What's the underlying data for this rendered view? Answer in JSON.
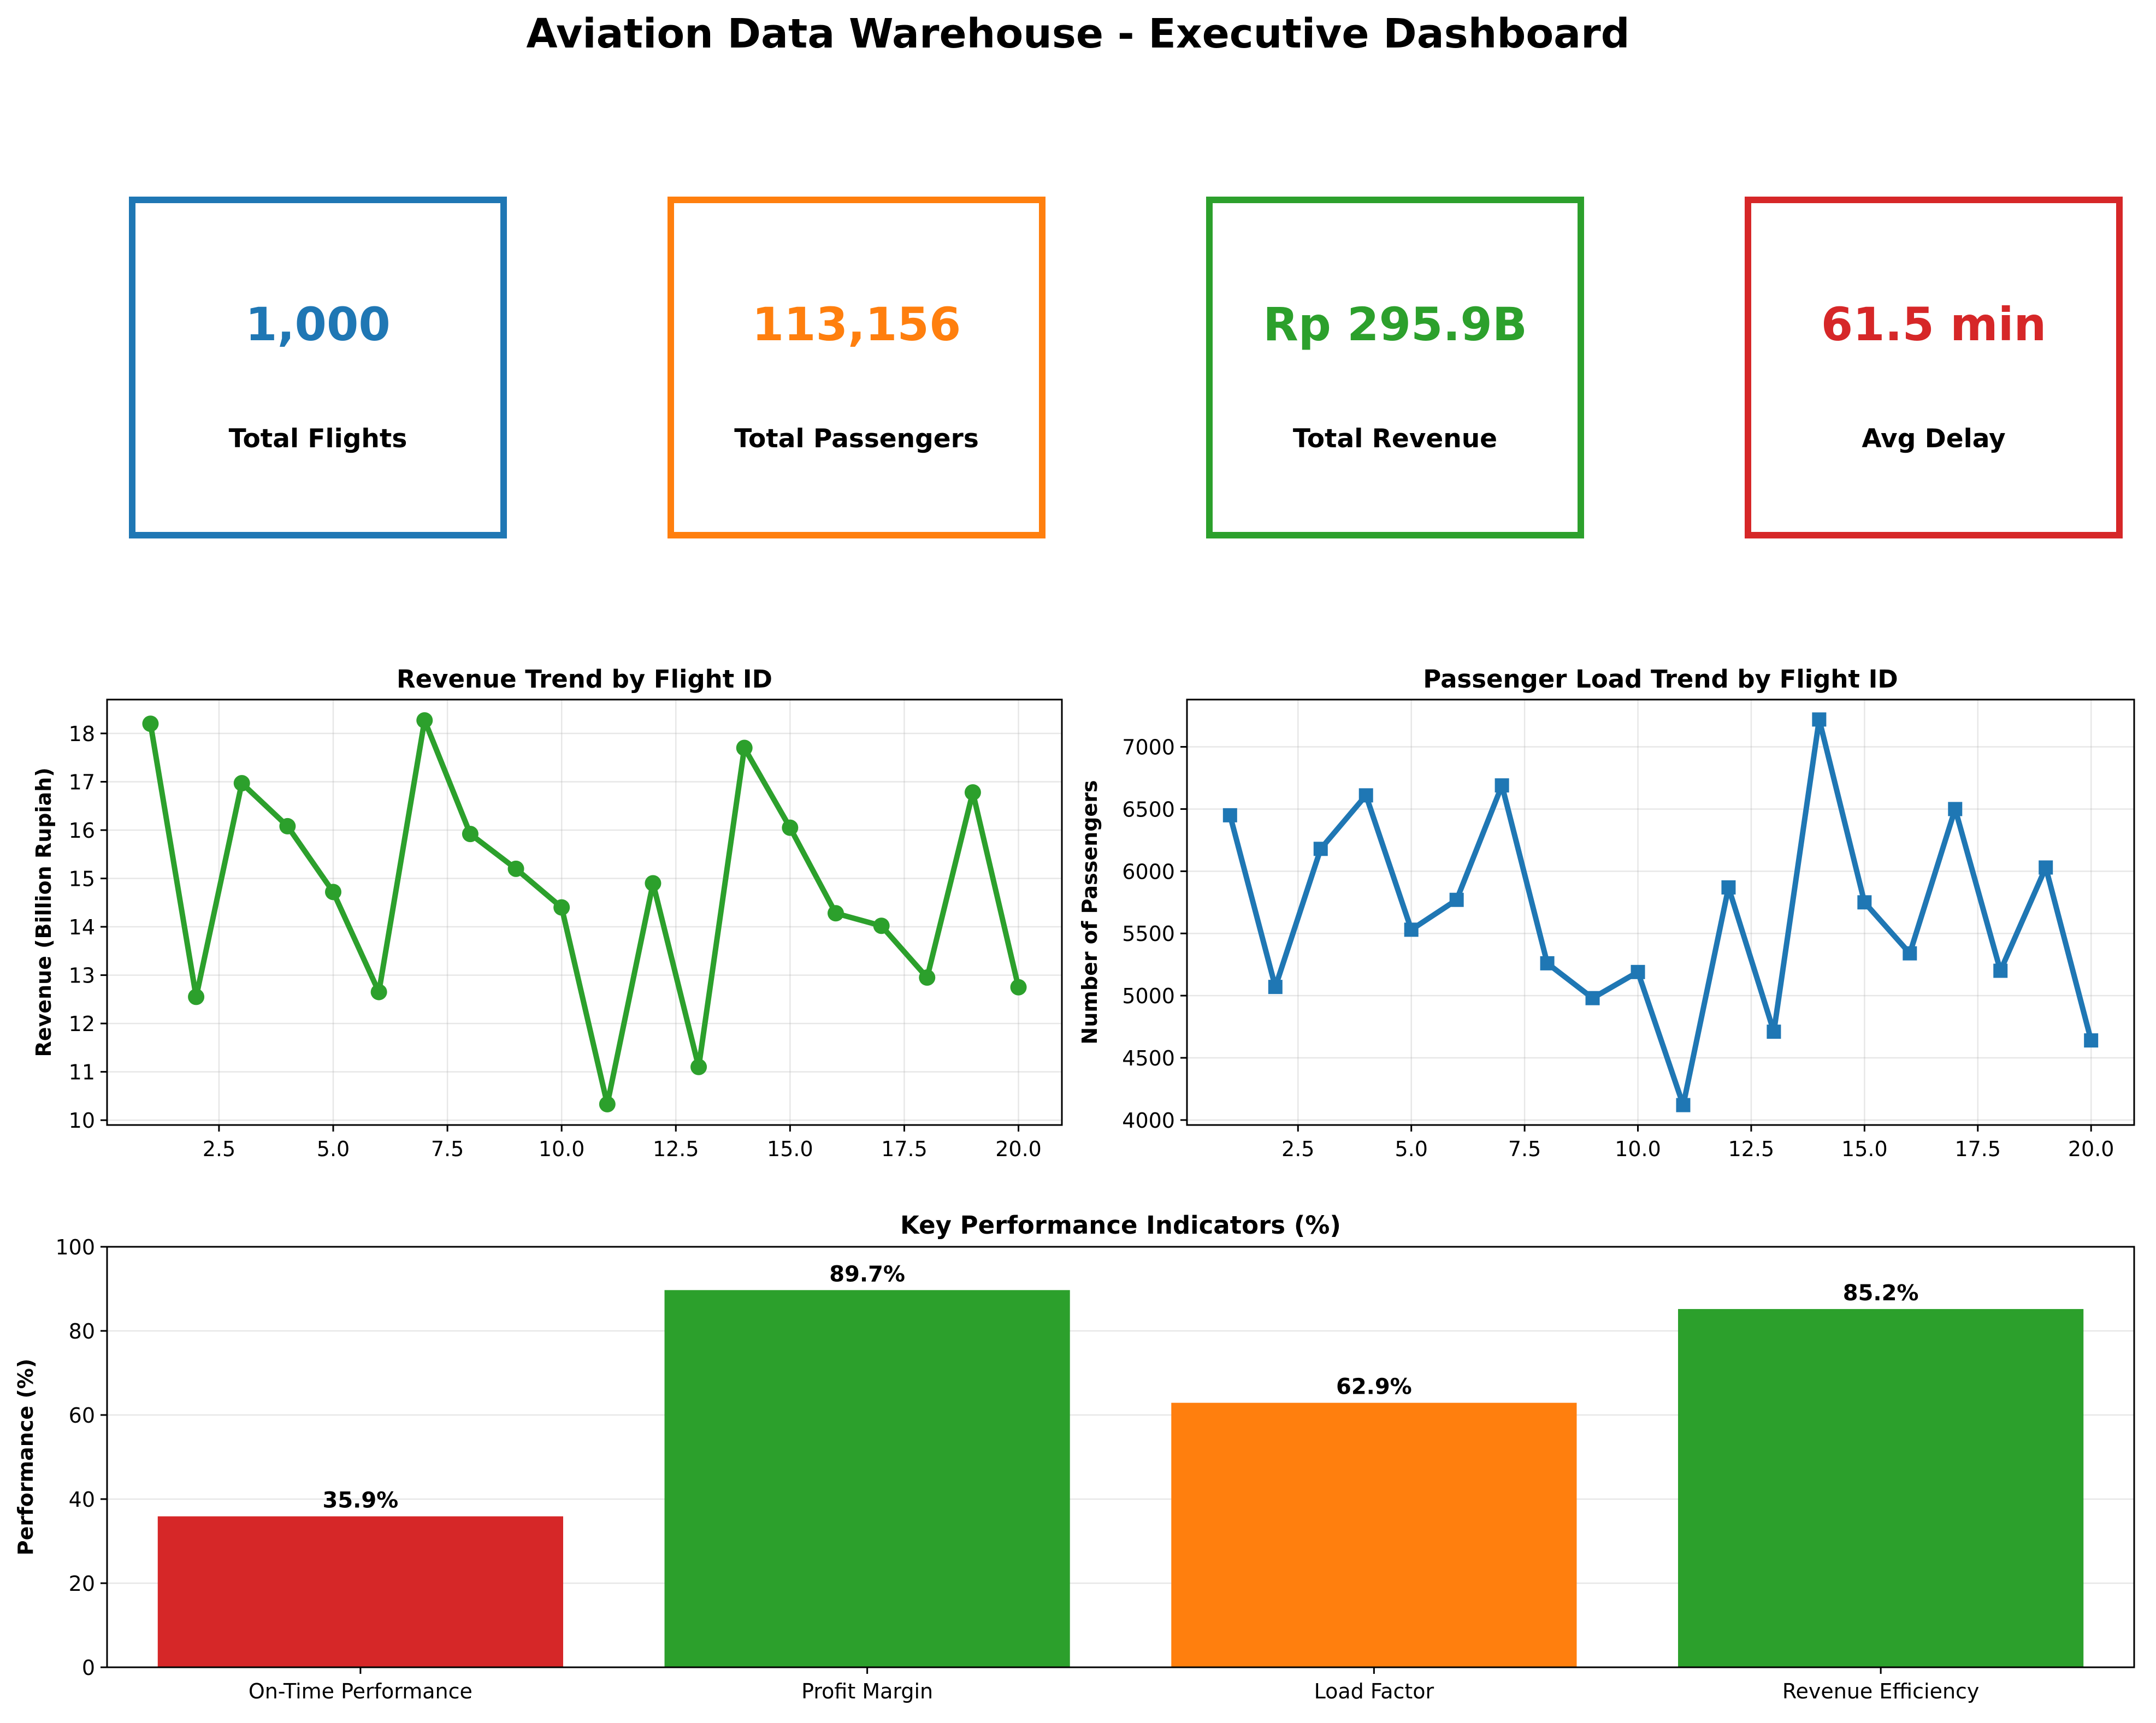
{
  "page": {
    "title": "Aviation Data Warehouse - Executive Dashboard"
  },
  "kpis": [
    {
      "value": "1,000",
      "label": "Total Flights",
      "color": "#1f77b4"
    },
    {
      "value": "113,156",
      "label": "Total Passengers",
      "color": "#ff7f0e"
    },
    {
      "value": "Rp 295.9B",
      "label": "Total Revenue",
      "color": "#2ca02c"
    },
    {
      "value": "61.5 min",
      "label": "Avg Delay",
      "color": "#d62728"
    }
  ],
  "chart_data": [
    {
      "type": "line",
      "title": "Revenue Trend by Flight ID",
      "xlabel": "",
      "ylabel": "Revenue (Billion Rupiah)",
      "color": "#2ca02c",
      "marker": "circle",
      "x": [
        1,
        2,
        3,
        4,
        5,
        6,
        7,
        8,
        9,
        10,
        11,
        12,
        13,
        14,
        15,
        16,
        17,
        18,
        19,
        20
      ],
      "y": [
        18.2,
        12.55,
        16.97,
        16.08,
        14.72,
        12.65,
        18.27,
        15.92,
        15.2,
        14.4,
        10.33,
        14.9,
        11.1,
        17.7,
        16.05,
        14.28,
        14.02,
        12.95,
        16.78,
        12.75
      ],
      "xlim": [
        0.05,
        20.95
      ],
      "ylim": [
        9.9,
        18.7
      ],
      "xticks": [
        2.5,
        5.0,
        7.5,
        10.0,
        12.5,
        15.0,
        17.5,
        20.0
      ],
      "xtick_labels": [
        "2.5",
        "5.0",
        "7.5",
        "10.0",
        "12.5",
        "15.0",
        "17.5",
        "20.0"
      ],
      "yticks": [
        10,
        11,
        12,
        13,
        14,
        15,
        16,
        17,
        18
      ],
      "ytick_labels": [
        "10",
        "11",
        "12",
        "13",
        "14",
        "15",
        "16",
        "17",
        "18"
      ],
      "grid": true
    },
    {
      "type": "line",
      "title": "Passenger Load Trend by Flight ID",
      "xlabel": "",
      "ylabel": "Number of Passengers",
      "color": "#1f77b4",
      "marker": "square",
      "x": [
        1,
        2,
        3,
        4,
        5,
        6,
        7,
        8,
        9,
        10,
        11,
        12,
        13,
        14,
        15,
        16,
        17,
        18,
        19,
        20
      ],
      "y": [
        6450,
        5070,
        6180,
        6610,
        5530,
        5770,
        6690,
        5260,
        4980,
        5190,
        4120,
        5870,
        4710,
        7220,
        5750,
        5340,
        6500,
        5200,
        6030,
        4640
      ],
      "xlim": [
        0.05,
        20.95
      ],
      "ylim": [
        3960,
        7380
      ],
      "xticks": [
        2.5,
        5.0,
        7.5,
        10.0,
        12.5,
        15.0,
        17.5,
        20.0
      ],
      "xtick_labels": [
        "2.5",
        "5.0",
        "7.5",
        "10.0",
        "12.5",
        "15.0",
        "17.5",
        "20.0"
      ],
      "yticks": [
        4000,
        4500,
        5000,
        5500,
        6000,
        6500,
        7000
      ],
      "ytick_labels": [
        "4000",
        "4500",
        "5000",
        "5500",
        "6000",
        "6500",
        "7000"
      ],
      "grid": true
    },
    {
      "type": "bar",
      "title": "Key Performance Indicators (%)",
      "xlabel": "",
      "ylabel": "Performance (%)",
      "categories": [
        "On-Time Performance",
        "Profit Margin",
        "Load Factor",
        "Revenue Efficiency"
      ],
      "values": [
        35.9,
        89.7,
        62.9,
        85.2
      ],
      "value_labels": [
        "35.9%",
        "89.7%",
        "62.9%",
        "85.2%"
      ],
      "colors": [
        "#d62728",
        "#2ca02c",
        "#ff7f0e",
        "#2ca02c"
      ],
      "ylim": [
        0,
        100
      ],
      "yticks": [
        0,
        20,
        40,
        60,
        80,
        100
      ],
      "ytick_labels": [
        "0",
        "20",
        "40",
        "60",
        "80",
        "100"
      ],
      "grid": "y"
    }
  ]
}
